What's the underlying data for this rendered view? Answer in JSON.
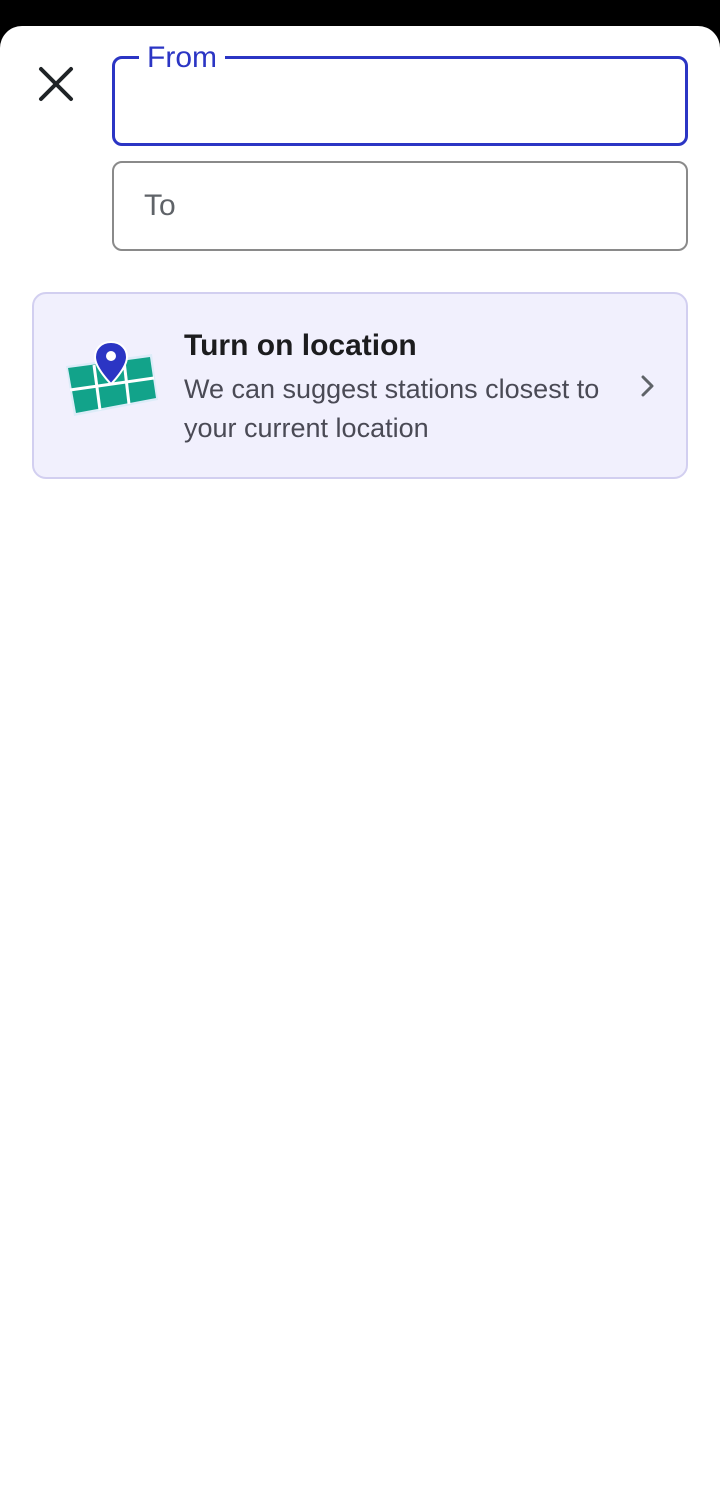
{
  "colors": {
    "accent": "#2b35c4",
    "card_background": "#f1f0fd",
    "map_green": "#12a38a"
  },
  "header": {
    "close_icon": "close-icon"
  },
  "from_field": {
    "label": "From",
    "value": ""
  },
  "to_field": {
    "placeholder": "To",
    "value": ""
  },
  "location_card": {
    "icon": "map-pin-illustration",
    "title": "Turn on location",
    "description": "We can suggest stations closest to your current location",
    "chevron_icon": "chevron-right-icon"
  }
}
